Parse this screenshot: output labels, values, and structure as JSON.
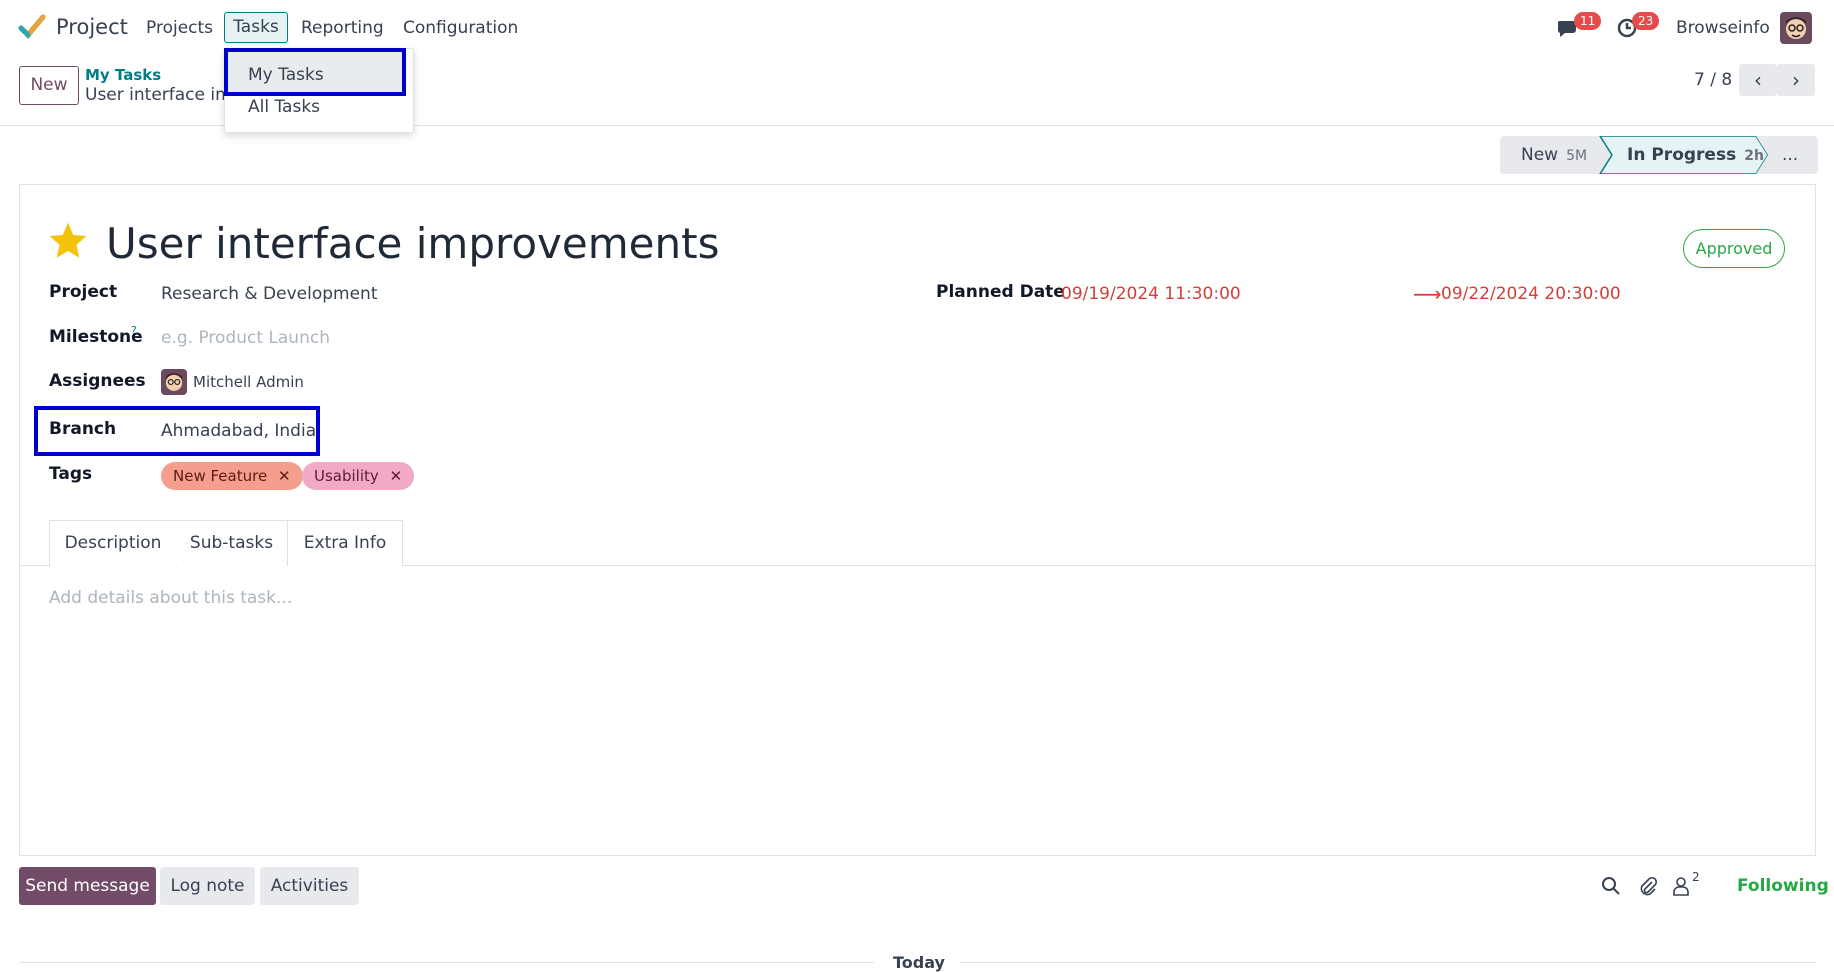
{
  "nav": {
    "app_name": "Project",
    "menu": [
      "Projects",
      "Tasks",
      "Reporting",
      "Configuration"
    ],
    "messages_count": "11",
    "activities_count": "23",
    "company": "Browseinfo"
  },
  "dropdown": {
    "items": [
      "My Tasks",
      "All Tasks"
    ]
  },
  "control": {
    "new_label": "New",
    "breadcrumb_parent": "My Tasks",
    "breadcrumb_current": "User interface improvements",
    "pager": "7 / 8",
    "prev_icon": "chevron-left-icon",
    "next_icon": "chevron-right-icon"
  },
  "statusbar": {
    "stages": [
      {
        "name": "New",
        "time": "5M"
      },
      {
        "name": "In Progress",
        "time": "2h"
      }
    ],
    "more": "..."
  },
  "task": {
    "title": "User interface improvements",
    "state": "Approved",
    "project_label": "Project",
    "project_value": "Research & Development",
    "milestone_label": "Milestone",
    "milestone_help": "?",
    "milestone_placeholder": "e.g. Product Launch",
    "assignees_label": "Assignees",
    "assignee": "Mitchell Admin",
    "branch_label": "Branch",
    "branch_value": "Ahmadabad, India",
    "tags_label": "Tags",
    "tags": [
      "New Feature",
      "Usability"
    ],
    "planned_label": "Planned Date",
    "planned_start": "09/19/2024 11:30:00",
    "planned_end": "09/22/2024 20:30:00"
  },
  "tabs": [
    "Description",
    "Sub-tasks",
    "Extra Info"
  ],
  "description_placeholder": "Add details about this task...",
  "chatter": {
    "send": "Send message",
    "log": "Log note",
    "activities": "Activities",
    "followers_count": "2",
    "following": "Following",
    "today": "Today"
  },
  "colors": {
    "brand": "#714b67",
    "accent": "#017e84",
    "danger": "#d23f3a",
    "success": "#28a745",
    "highlight": "#0000cc"
  }
}
